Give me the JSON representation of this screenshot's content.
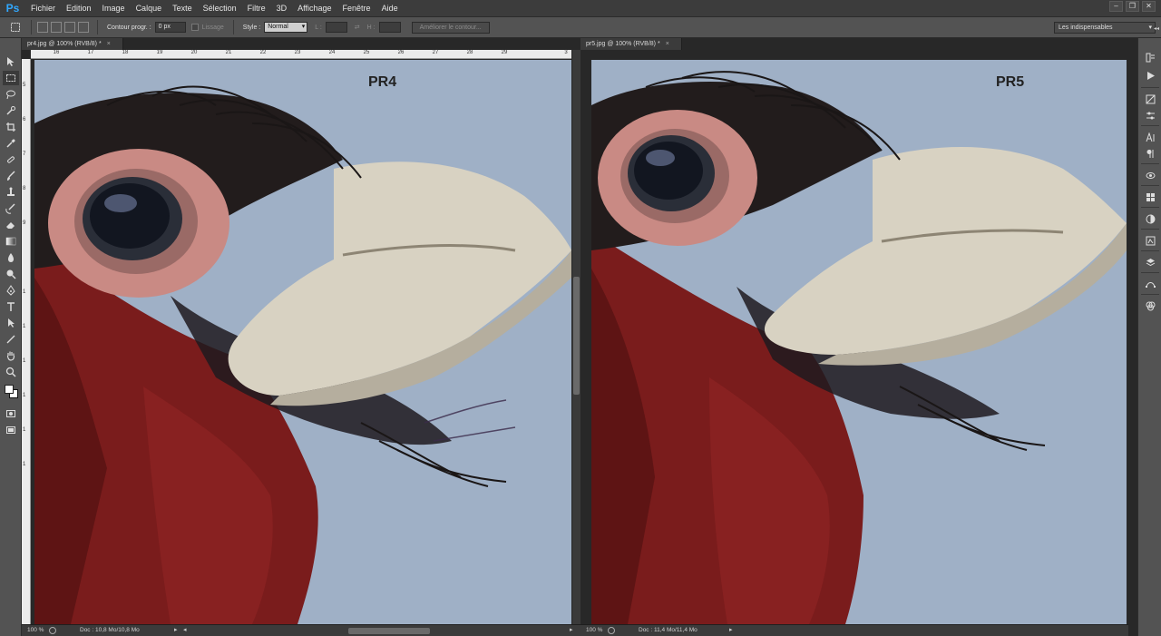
{
  "app": {
    "logo": "Ps"
  },
  "menu": [
    "Fichier",
    "Edition",
    "Image",
    "Calque",
    "Texte",
    "Sélection",
    "Filtre",
    "3D",
    "Affichage",
    "Fenêtre",
    "Aide"
  ],
  "window_controls": {
    "minimize": "–",
    "restore": "❐",
    "close": "✕"
  },
  "options": {
    "feather_label": "Contour progr. :",
    "feather_value": "0 px",
    "antialias_label": "Lissage",
    "style_label": "Style :",
    "style_value": "Normal",
    "width_label": "L :",
    "height_label": "H :",
    "refine_button": "Améliorer le contour...",
    "workspace": "Les indispensables"
  },
  "documents": [
    {
      "tab_title": "pr4.jpg @ 100% (RVB/8) *",
      "overlay_label": "PR4",
      "ruler_top": [
        "16",
        "17",
        "18",
        "19",
        "20",
        "21",
        "22",
        "23",
        "24",
        "25",
        "26",
        "27",
        "28",
        "29",
        "3"
      ],
      "ruler_left": [
        "5",
        "6",
        "7",
        "8",
        "9",
        "1",
        "1",
        "1",
        "1",
        "1",
        "1"
      ],
      "status_zoom": "100 %",
      "status_doc": "Doc : 10,8 Mo/10,8 Mo"
    },
    {
      "tab_title": "pr5.jpg @ 100% (RVB/8) *",
      "overlay_label": "PR5",
      "status_zoom": "100 %",
      "status_doc": "Doc : 11,4 Mo/11,4 Mo"
    }
  ],
  "colors": {
    "sky": "#9fb0c6",
    "feather_red": "#7a1c1c",
    "beak": "#d8d2c2",
    "eye_ring": "#c98a84"
  }
}
